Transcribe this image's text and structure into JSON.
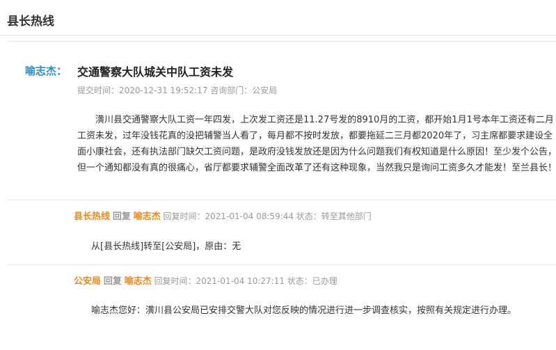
{
  "page": {
    "title": "县长热线"
  },
  "question": {
    "asker": "喻志杰：",
    "title": "交通警察大队城关中队工资未发",
    "meta": "提交时间：2020-12-31 19:52:17 咨询部门：公安局",
    "body": "潢川县交通警察大队工资一年四发，上次发工资还是11.27号发的8910月的工资，都开始1月1号本年工资还有二月工资未发，过年没钱花真的没把辅警当人看了，每月都不按时发放，都要拖延二三月都2020年了，习主席都要求建设全面小康社会，还有执法部门缺欠工资问题，是政府没钱发放还是因为什么问题我们有权知道是什么原因！至少发个公告，但一个通知都没有真的很痛心，省厅都要求辅警全面改革了还有这种现象，当然我只是询问工资多久才能发！至兰县长！"
  },
  "replies": [
    {
      "from": "县长热线",
      "verb": "回复",
      "to": "喻志杰",
      "meta": "回复时间：2021-01-04 08:59:44 状态：转至其他部门",
      "body": "从[县长热线]转至[公安局]，原由：无"
    },
    {
      "from": "公安局",
      "verb": "回复",
      "to": "喻志杰",
      "meta": "回复时间：2021-01-04 10:27:11 状态：已办理",
      "body": "喻志杰您好：潢川县公安局已安排交警大队对您反映的情况进行进一步调查核实，按照有关规定进行办理。"
    }
  ]
}
